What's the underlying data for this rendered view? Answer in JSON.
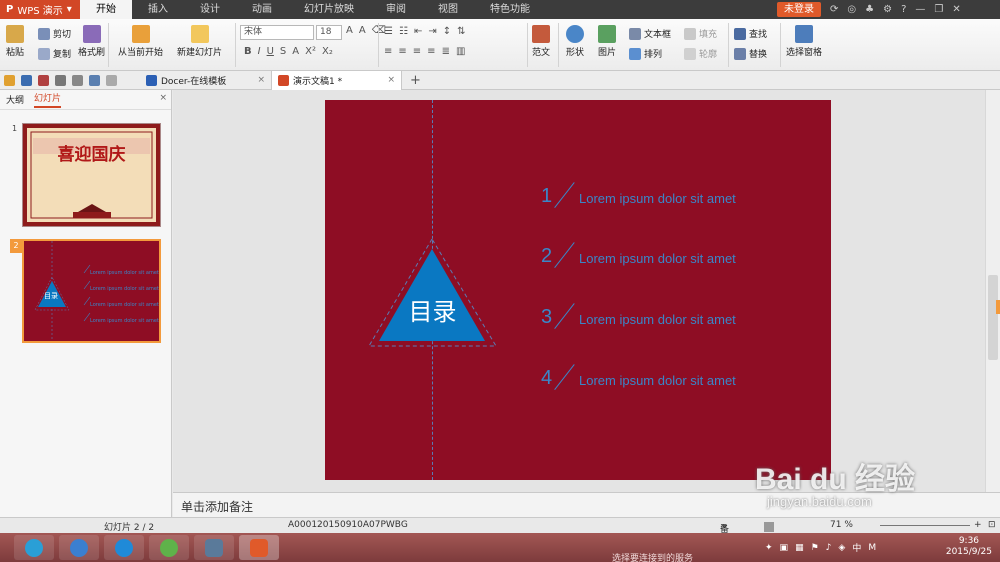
{
  "titlebar": {
    "app_logo": "P",
    "app_name": "WPS 演示",
    "tabs": [
      "开始",
      "插入",
      "设计",
      "动画",
      "幻灯片放映",
      "审阅",
      "视图",
      "特色功能"
    ],
    "active_tab": "开始",
    "login_label": "未登录",
    "help_label": "?"
  },
  "ribbon": {
    "paste_label": "粘贴",
    "cut_label": "剪切",
    "copy_label": "复制",
    "format_painter_label": "格式刷",
    "from_current_label": "从当前开始",
    "new_slide_label": "新建幻灯片",
    "font_name": "宋体",
    "font_size": "18",
    "template_label": "范文",
    "shape_label": "形状",
    "picture_label": "图片",
    "textbox_label": "文本框",
    "fill_label": "填充",
    "arrange_label": "排列",
    "outline_label": "轮廓",
    "find_label": "查找",
    "replace_label": "替换",
    "selection_pane_label": "选择窗格"
  },
  "quickbar": {
    "tabs": [
      {
        "label": "Docer-在线模板",
        "close": "×"
      },
      {
        "label": "演示文稿1 *",
        "close": "×"
      }
    ],
    "add_tab": "+"
  },
  "leftpanel": {
    "tab_outline": "大纲",
    "tab_slides": "幻灯片",
    "close": "×",
    "slide1_num": "1",
    "slide1_title": "喜迎国庆",
    "slide2_num": "2",
    "slide2_toc_label": "目录",
    "slide2_item_text": "Lorem ipsum dolor sit amet"
  },
  "slide": {
    "toc_label": "目录",
    "items": [
      {
        "num": "1",
        "text": "Lorem ipsum dolor sit amet"
      },
      {
        "num": "2",
        "text": "Lorem ipsum dolor sit amet"
      },
      {
        "num": "3",
        "text": "Lorem ipsum dolor sit amet"
      },
      {
        "num": "4",
        "text": "Lorem ipsum dolor sit amet"
      }
    ],
    "colors": {
      "background": "#8e0d24",
      "accent": "#3a86c8",
      "triangle": "#0a78c2"
    }
  },
  "notes": {
    "placeholder": "单击添加备注"
  },
  "statusbar": {
    "slide_counter": "幻灯片 2 / 2",
    "template_id": "A000120150910A07PWBG",
    "notes_label": "备注",
    "zoom_label": "71 %"
  },
  "taskbar": {
    "ime_label": "中",
    "clock_time": "9:36",
    "clock_date": "2015/9/25",
    "background_text": "选择要连接到的服务"
  },
  "watermark": {
    "main": "Bai du 经验",
    "sub": "jingyan.baidu.com"
  }
}
